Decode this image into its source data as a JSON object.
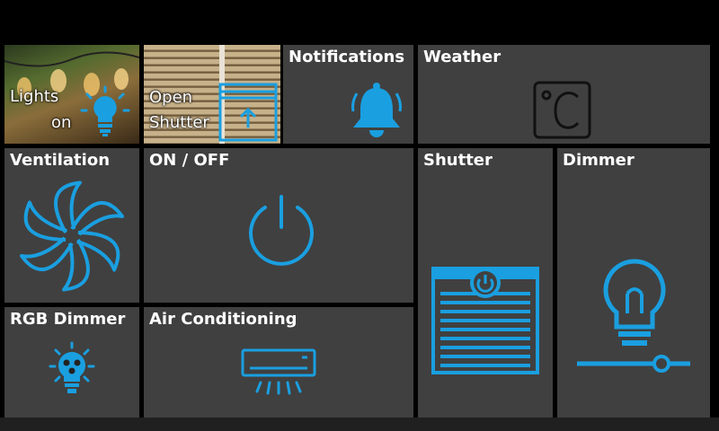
{
  "colors": {
    "accent": "#1a9fe0",
    "tile": "#404040",
    "background": "#000000",
    "text": "#ffffff"
  },
  "tiles": {
    "lights": {
      "label_line1": "Lights",
      "label_line2": "on",
      "icon": "lightbulb-icon"
    },
    "open_shutter": {
      "label_line1": "Open",
      "label_line2": "Shutter",
      "icon": "shutter-up-icon"
    },
    "notifications": {
      "label": "Notifications",
      "icon": "bell-icon"
    },
    "weather": {
      "label": "Weather",
      "icon": "celsius-icon"
    },
    "ventilation": {
      "label": "Ventilation",
      "icon": "fan-icon"
    },
    "on_off": {
      "label": "ON / OFF",
      "icon": "power-icon"
    },
    "shutter": {
      "label": "Shutter",
      "icon": "shutter-icon"
    },
    "dimmer": {
      "label": "Dimmer",
      "icon": "dimmer-bulb-icon"
    },
    "rgb_dimmer": {
      "label": "RGB Dimmer",
      "icon": "rgb-bulb-icon"
    },
    "air_conditioning": {
      "label": "Air Conditioning",
      "icon": "air-conditioner-icon"
    }
  }
}
